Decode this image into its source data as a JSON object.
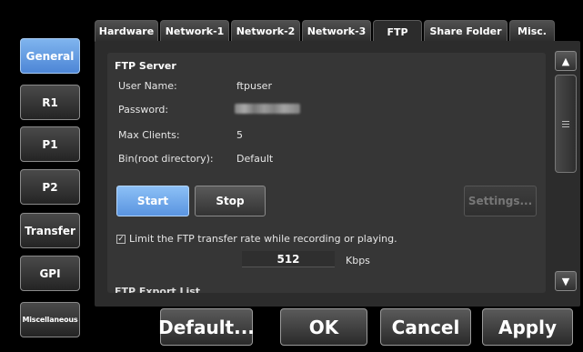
{
  "nav": {
    "items": [
      {
        "label": "General",
        "active": true
      },
      {
        "label": "R1"
      },
      {
        "label": "P1"
      },
      {
        "label": "P2"
      },
      {
        "label": "Transfer"
      },
      {
        "label": "GPI"
      },
      {
        "label": "Miscellaneous"
      }
    ]
  },
  "tabs": [
    {
      "label": "Hardware"
    },
    {
      "label": "Network-1"
    },
    {
      "label": "Network-2"
    },
    {
      "label": "Network-3"
    },
    {
      "label": "FTP",
      "active": true
    },
    {
      "label": "Share Folder"
    },
    {
      "label": "Misc."
    }
  ],
  "ftp": {
    "section_title": "FTP Server",
    "fields": {
      "user_name": {
        "label": "User Name:",
        "value": "ftpuser"
      },
      "password": {
        "label": "Password:"
      },
      "max_clients": {
        "label": "Max Clients:",
        "value": "5"
      },
      "bin": {
        "label": "Bin(root directory):",
        "value": "Default"
      }
    },
    "buttons": {
      "start": "Start",
      "stop": "Stop",
      "settings": "Settings..."
    },
    "limit_checkbox": {
      "label": "Limit the FTP transfer rate while recording or playing.",
      "checked": true,
      "mark": "✓"
    },
    "rate": {
      "value": "512",
      "unit": "Kbps"
    },
    "next_section_title": "FTP Export List"
  },
  "scrollbar": {
    "up_icon": "▲",
    "down_icon": "▼"
  },
  "footer": {
    "default": "Default...",
    "ok": "OK",
    "cancel": "Cancel",
    "apply": "Apply"
  },
  "colors": {
    "accent": "#5a94e0",
    "background": "#000000",
    "panel": "#2c2c2c"
  }
}
